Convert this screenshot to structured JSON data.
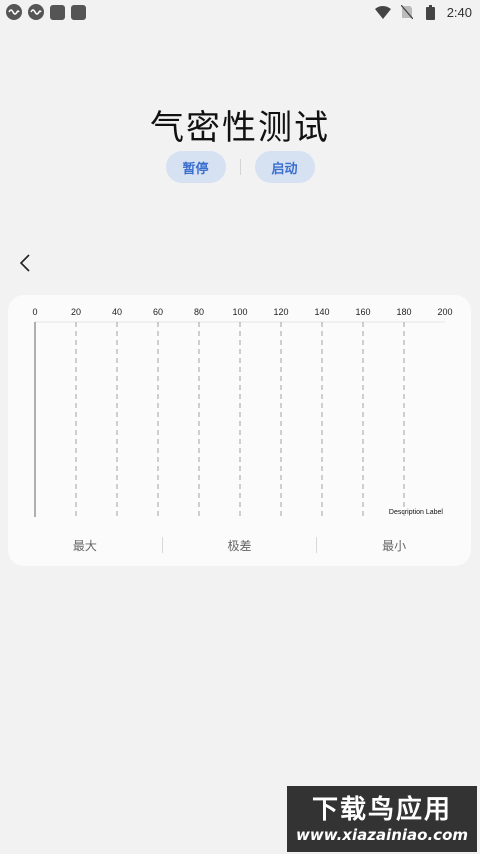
{
  "status_bar": {
    "time": "2:40",
    "left_icons": [
      "cn-badge-icon",
      "cn-badge-icon",
      "app-square-icon",
      "app-square-icon"
    ],
    "right_icons": [
      "wifi-icon",
      "no-sim-icon",
      "battery-icon"
    ]
  },
  "header": {
    "title": "气密性测试",
    "pause_label": "暂停",
    "start_label": "启动"
  },
  "chart_data": {
    "type": "line",
    "x_ticks": [
      "0",
      "20",
      "40",
      "60",
      "80",
      "100",
      "120",
      "140",
      "160",
      "180",
      "200"
    ],
    "xlim": [
      0,
      200
    ],
    "series": [],
    "grid": true,
    "description_label": "Description Label"
  },
  "stats": {
    "max_label": "最大",
    "range_label": "极差",
    "min_label": "最小"
  },
  "watermark": {
    "title": "下载鸟应用",
    "url": "www.xiazainiao.com"
  }
}
